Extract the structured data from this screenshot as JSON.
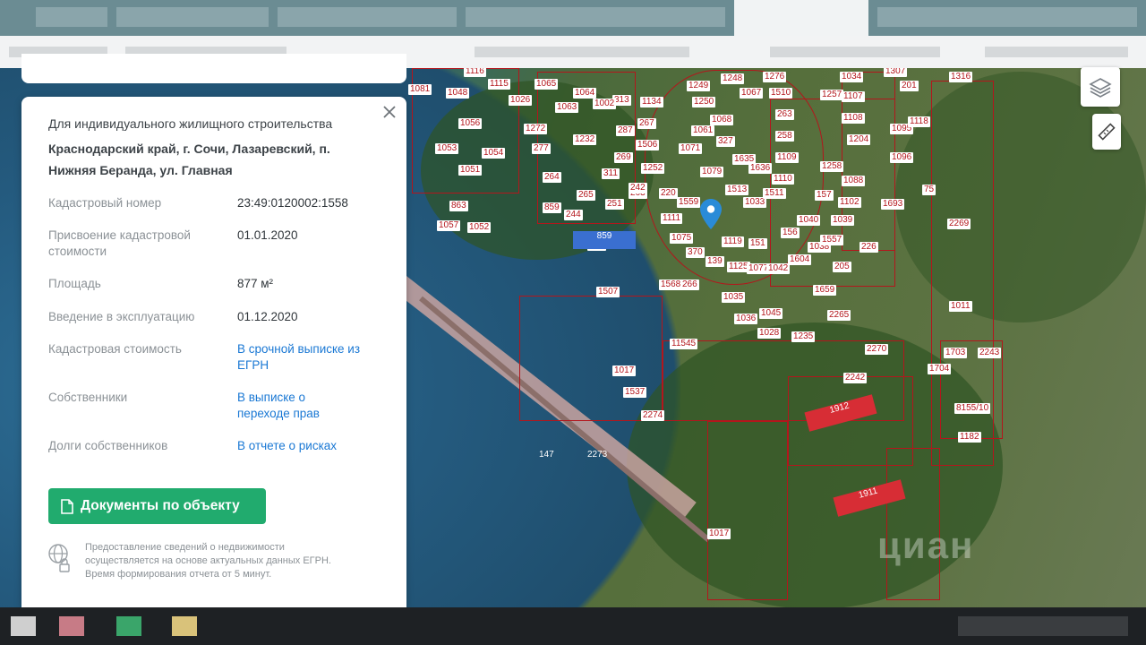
{
  "panel": {
    "object_type": "Для индивидуального жилищного строительства",
    "address": "Краснодарский край, г. Сочи, Лазаревский, п. Нижняя Беранда, ул. Главная",
    "rows": [
      {
        "key": "Кадастровый номер",
        "value": "23:49:0120002:1558"
      },
      {
        "key": "Присвоение кадастровой стоимости",
        "value": "01.01.2020"
      },
      {
        "key": "Площадь",
        "value": "877 м²"
      },
      {
        "key": "Введение в эксплуатацию",
        "value": "01.12.2020"
      },
      {
        "key": "Кадастровая стоимость",
        "value": "В срочной выписке из ЕГРН"
      },
      {
        "key": "Собственники",
        "value": "В выписке о переходе прав"
      },
      {
        "key": "Долги собственников",
        "value": "В отчете о рисках"
      }
    ],
    "documents_button": "Документы по объекту",
    "footnote": "Предоставление сведений о недвижимости осуществляется на основе актуальных данных ЕГРН. Время формирования отчета от 5 минут."
  },
  "map": {
    "parcel_labels": [
      "1116",
      "1115",
      "1065",
      "1064",
      "313",
      "1134",
      "1249",
      "1248",
      "1276",
      "1034",
      "1307",
      "201",
      "1316",
      "1081",
      "1048",
      "1026",
      "1063",
      "1002",
      "1250",
      "1067",
      "1510",
      "1257",
      "1107",
      "1056",
      "1272",
      "277",
      "1232",
      "287",
      "267",
      "1068",
      "263",
      "1108",
      "1095",
      "1118",
      "1053",
      "1054",
      "1506",
      "1061",
      "327",
      "1071",
      "258",
      "1204",
      "1109",
      "1051",
      "264",
      "311",
      "265",
      "269",
      "1252",
      "1079",
      "1635",
      "1636",
      "1110",
      "1258",
      "1088",
      "1096",
      "263",
      "244",
      "251",
      "242",
      "220",
      "1559",
      "1513",
      "1033",
      "1511",
      "157",
      "1102",
      "1693",
      "75",
      "2269",
      "1057",
      "863",
      "1052",
      "859",
      "240",
      "1111",
      "1075",
      "1119",
      "151",
      "156",
      "1040",
      "1039",
      "1038",
      "1557",
      "1507",
      "1568",
      "266",
      "370",
      "139",
      "1125",
      "1077",
      "1042",
      "1604",
      "205",
      "226",
      "1659",
      "1035",
      "1036",
      "1045",
      "1028",
      "1235",
      "2265",
      "1011",
      "11545",
      "2270",
      "2243",
      "1703",
      "1017",
      "2242",
      "1704",
      "1537",
      "2274",
      "8155/10",
      "147",
      "2273",
      "1182",
      "1017"
    ],
    "buildings": [
      "1912",
      "1911"
    ],
    "watermark": "циан"
  },
  "icons": {
    "close": "close-icon",
    "layers": "layers-icon",
    "ruler": "ruler-icon",
    "document": "document-icon",
    "pin": "map-pin-icon",
    "lock_globe": "globe-lock-icon"
  },
  "colors": {
    "accent_green": "#21ab6e",
    "link_blue": "#1a78d4",
    "parcel_red": "#b3161c",
    "pin_blue": "#2a8bd8"
  }
}
